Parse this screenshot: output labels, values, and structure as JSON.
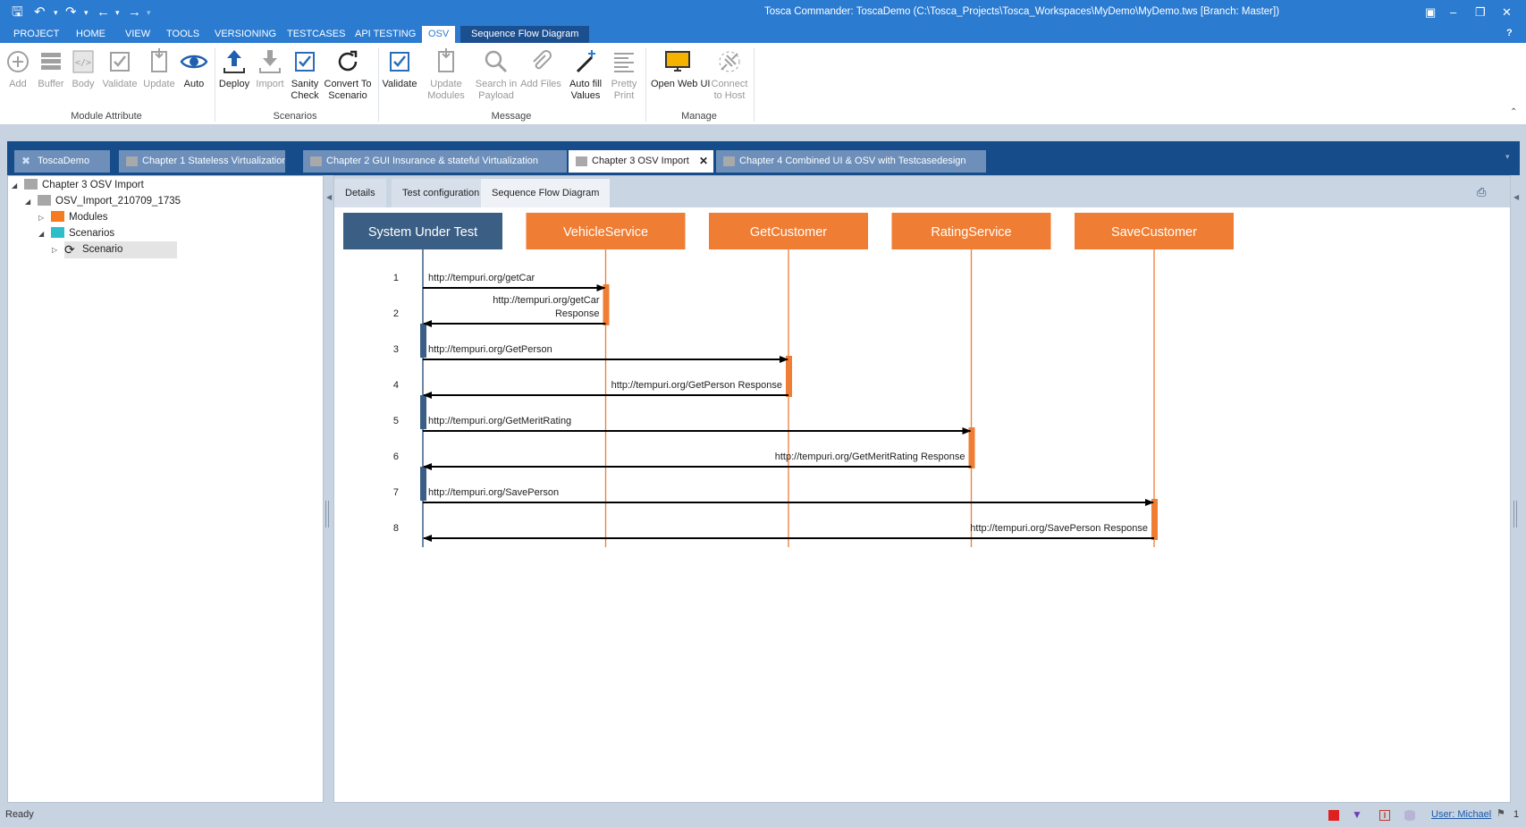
{
  "window": {
    "title": "Tosca Commander: ToscaDemo (C:\\Tosca_Projects\\Tosca_Workspaces\\MyDemo\\MyDemo.tws [Branch: Master])",
    "help": "?"
  },
  "menu": {
    "tabs": [
      "PROJECT",
      "HOME",
      "VIEW",
      "TOOLS",
      "VERSIONING",
      "TESTCASES",
      "API TESTING",
      "OSV"
    ],
    "context_tab": "Sequence Flow Diagram"
  },
  "ribbon": {
    "groups": [
      {
        "label": "Module Attribute",
        "buttons": [
          {
            "label": "Add",
            "icon": "add-circle-icon",
            "enabled": false
          },
          {
            "label": "Buffer",
            "icon": "buffer-icon",
            "enabled": false
          },
          {
            "label": "Body",
            "icon": "code-icon",
            "enabled": false
          },
          {
            "label": "Validate",
            "icon": "checkbox-icon",
            "enabled": false
          },
          {
            "label": "Update",
            "icon": "update-icon",
            "enabled": false
          },
          {
            "label": "Auto",
            "icon": "eye-icon",
            "enabled": true
          }
        ]
      },
      {
        "label": "Scenarios",
        "buttons": [
          {
            "label": "Deploy",
            "icon": "upload-icon",
            "enabled": true
          },
          {
            "label": "Import",
            "icon": "download-icon",
            "enabled": false
          },
          {
            "label": "Sanity\nCheck",
            "icon": "checkbox-icon",
            "enabled": true
          },
          {
            "label": "Convert To\nScenario",
            "icon": "refresh-icon",
            "enabled": true
          }
        ]
      },
      {
        "label": "Message",
        "buttons": [
          {
            "label": "Validate",
            "icon": "checkbox-icon",
            "enabled": true
          },
          {
            "label": "Update\nModules",
            "icon": "update-icon",
            "enabled": false
          },
          {
            "label": "Search in\nPayload",
            "icon": "search-icon",
            "enabled": false
          },
          {
            "label": "Add Files",
            "icon": "paperclip-icon",
            "enabled": false
          },
          {
            "label": "Auto fill\nValues",
            "icon": "magic-wand-icon",
            "enabled": true
          },
          {
            "label": "Pretty\nPrint",
            "icon": "lines-icon",
            "enabled": false
          }
        ]
      },
      {
        "label": "Manage",
        "buttons": [
          {
            "label": "Open Web UI",
            "icon": "monitor-icon",
            "enabled": true
          },
          {
            "label": "Connect\nto Host",
            "icon": "connect-icon",
            "enabled": false
          }
        ]
      }
    ]
  },
  "doc_tabs": [
    {
      "label": "ToscaDemo",
      "active": false
    },
    {
      "label": "Chapter 1 Stateless Virtualization",
      "active": false
    },
    {
      "label": "Chapter 2 GUI Insurance & stateful Virtualization",
      "active": false
    },
    {
      "label": "Chapter 3 OSV Import",
      "active": true
    },
    {
      "label": "Chapter 4 Combined UI & OSV with Testcasedesign",
      "active": false
    }
  ],
  "tree": [
    {
      "label": "Chapter 3 OSV Import",
      "level": 0,
      "icon": "folder-gray",
      "expanded": true
    },
    {
      "label": "OSV_Import_210709_1735",
      "level": 1,
      "icon": "folder-gray",
      "expanded": true
    },
    {
      "label": "Modules",
      "level": 2,
      "icon": "folder-orange",
      "expanded": false
    },
    {
      "label": "Scenarios",
      "level": 2,
      "icon": "folder-teal",
      "expanded": true
    },
    {
      "label": "Scenario",
      "level": 3,
      "icon": "scenario",
      "expanded": false,
      "selected": true
    }
  ],
  "sub_tabs": [
    {
      "label": "Details",
      "active": false
    },
    {
      "label": "Test configuration",
      "active": false
    },
    {
      "label": "Sequence Flow Diagram",
      "active": true
    }
  ],
  "sequence": {
    "participants": [
      {
        "name": "System Under Test",
        "color": "#3b5f84"
      },
      {
        "name": "VehicleService",
        "color": "#ef7d33"
      },
      {
        "name": "GetCustomer",
        "color": "#ef7d33"
      },
      {
        "name": "RatingService",
        "color": "#ef7d33"
      },
      {
        "name": "SaveCustomer",
        "color": "#ef7d33"
      }
    ],
    "messages": [
      {
        "n": "1",
        "from": 0,
        "to": 1,
        "lines": [
          "http://tempuri.org/getCar"
        ]
      },
      {
        "n": "2",
        "from": 1,
        "to": 0,
        "lines": [
          "http://tempuri.org/getCar",
          "Response"
        ]
      },
      {
        "n": "3",
        "from": 0,
        "to": 2,
        "lines": [
          "http://tempuri.org/GetPerson"
        ]
      },
      {
        "n": "4",
        "from": 2,
        "to": 0,
        "lines": [
          "http://tempuri.org/GetPerson Response"
        ]
      },
      {
        "n": "5",
        "from": 0,
        "to": 3,
        "lines": [
          "http://tempuri.org/GetMeritRating"
        ]
      },
      {
        "n": "6",
        "from": 3,
        "to": 0,
        "lines": [
          "http://tempuri.org/GetMeritRating Response"
        ]
      },
      {
        "n": "7",
        "from": 0,
        "to": 4,
        "lines": [
          "http://tempuri.org/SavePerson"
        ]
      },
      {
        "n": "8",
        "from": 4,
        "to": 0,
        "lines": [
          "http://tempuri.org/SavePerson Response"
        ]
      }
    ]
  },
  "status": {
    "text": "Ready",
    "user": "User: Michael",
    "count": "1"
  }
}
